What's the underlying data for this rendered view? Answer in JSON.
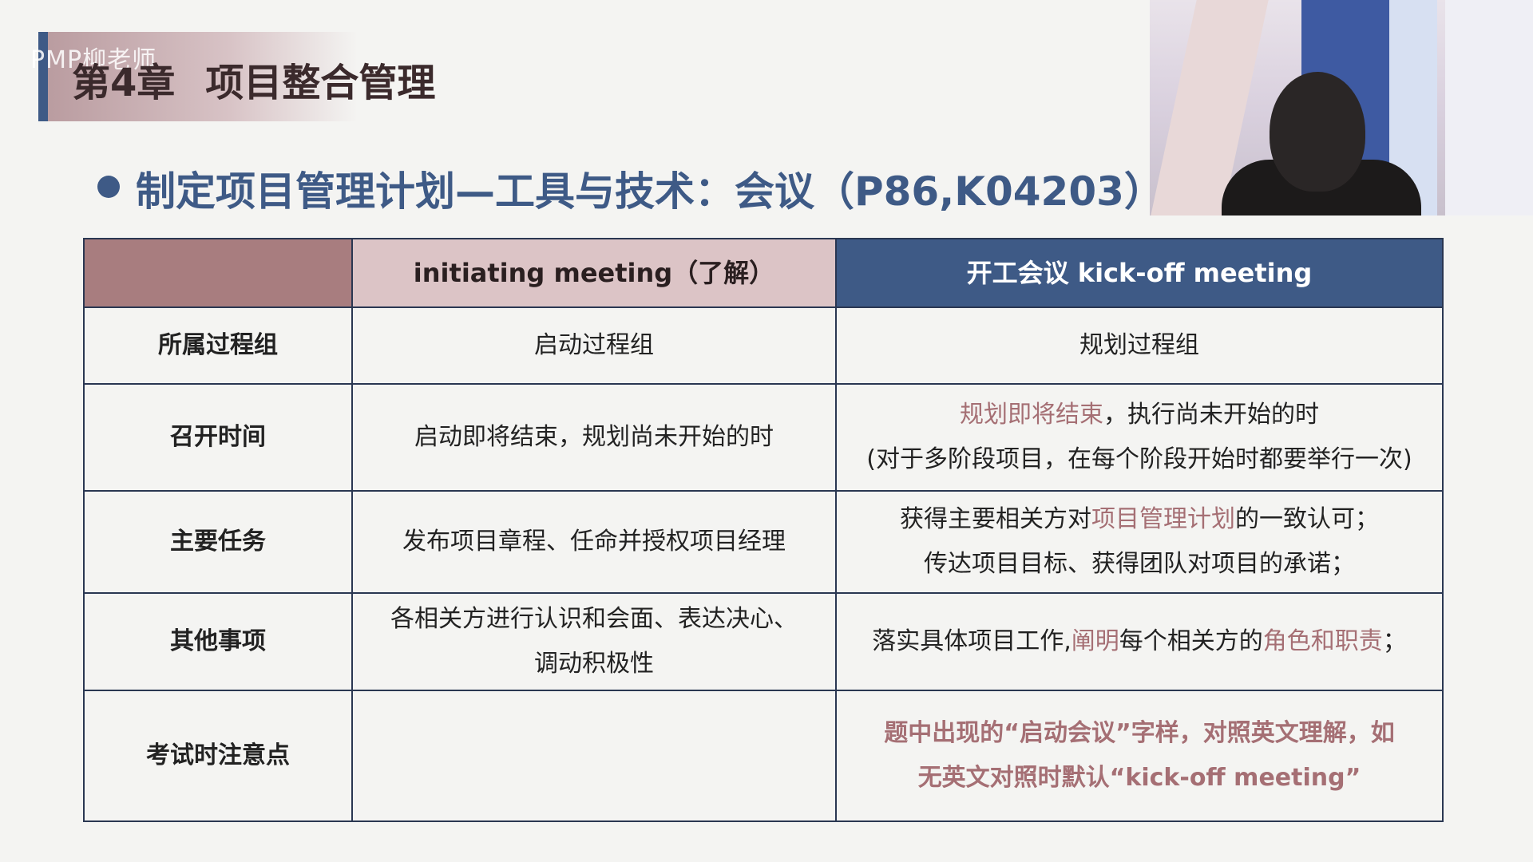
{
  "banner": {
    "watermark": "PMP柳老师",
    "chapter": "第4章",
    "chapter_title": "项目整合管理"
  },
  "heading": "制定项目管理计划—工具与技术：会议（P86,K04203）",
  "table": {
    "headers": {
      "col1": "",
      "col2": "initiating meeting（了解）",
      "col3": "开工会议 kick-off meeting"
    },
    "rows": [
      {
        "label": "所属过程组",
        "initiating": "启动过程组",
        "kickoff": "规划过程组"
      },
      {
        "label": "召开时间",
        "initiating": "启动即将结束，规划尚未开始的时",
        "kickoff_accent": "规划即将结束",
        "kickoff_rest": "，执行尚未开始的时",
        "kickoff_line2": "(对于多阶段项目，在每个阶段开始时都要举行一次)"
      },
      {
        "label": "主要任务",
        "initiating": "发布项目章程、任命并授权项目经理",
        "kickoff_pre": "获得主要相关方对",
        "kickoff_accent": "项目管理计划",
        "kickoff_post": "的一致认可；",
        "kickoff_line2": "传达项目目标、获得团队对项目的承诺；"
      },
      {
        "label": "其他事项",
        "initiating_line1": "各相关方进行认识和会面、表达决心、",
        "initiating_line2": "调动积极性",
        "kickoff_pre": "落实具体项目工作,",
        "kickoff_accent1": "阐明",
        "kickoff_mid": "每个相关方的",
        "kickoff_accent2": "角色和职责",
        "kickoff_post": "；"
      },
      {
        "label": "考试时注意点",
        "initiating": "",
        "kickoff_line1": "题中出现的“启动会议”字样，对照英文理解，如",
        "kickoff_line2": "无英文对照时默认“kick-off meeting”"
      }
    ]
  },
  "colors": {
    "accent_blue": "#3e5a86",
    "accent_rose": "#a56f74",
    "header_rose": "#dcc4c6",
    "header_dark_rose": "#a87d7f"
  }
}
